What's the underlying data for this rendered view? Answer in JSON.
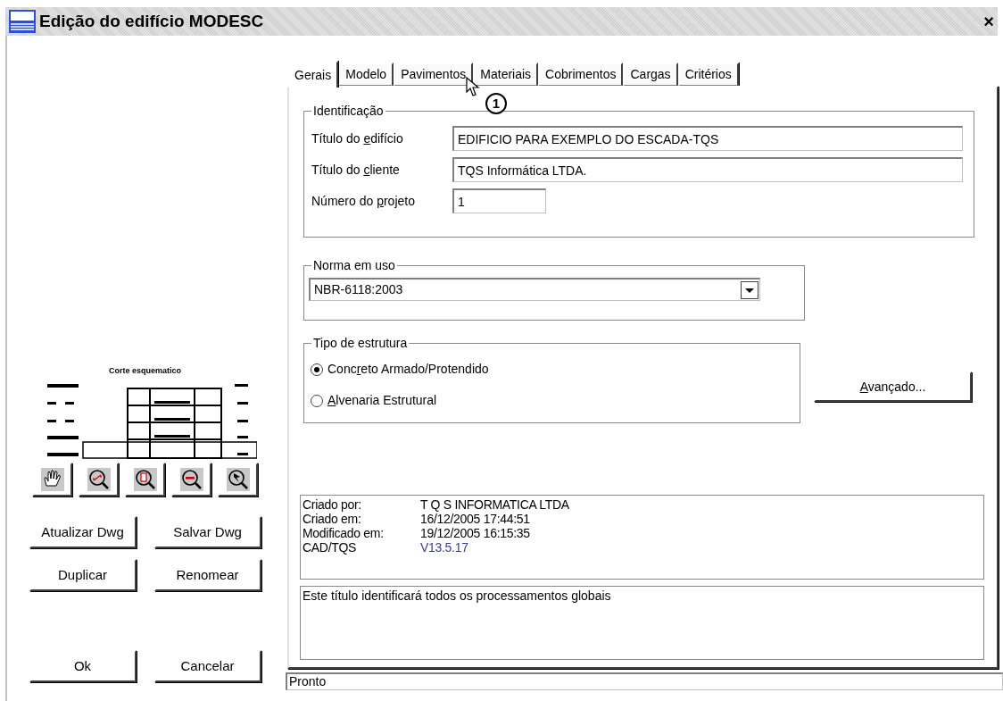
{
  "window": {
    "title": "Edição do edifício MODESC",
    "close": "×"
  },
  "preview": {
    "caption": "Corte esquematico"
  },
  "zoom_tools": [
    {
      "kind": "pan"
    },
    {
      "kind": "zoom-window"
    },
    {
      "kind": "zoom-page"
    },
    {
      "kind": "zoom-out"
    },
    {
      "kind": "zoom-previous"
    }
  ],
  "left_buttons": [
    {
      "label": "Atualizar Dwg"
    },
    {
      "label": "Salvar Dwg"
    },
    {
      "label": "Duplicar"
    },
    {
      "label": "Renomear"
    }
  ],
  "dialog_buttons": [
    {
      "label": "Ok"
    },
    {
      "label": "Cancelar"
    }
  ],
  "tabs": [
    {
      "label": "Gerais",
      "selected": true
    },
    {
      "label": "Modelo",
      "selected": false
    },
    {
      "label": "Pavimentos",
      "selected": false
    },
    {
      "label": "Materiais",
      "selected": false
    },
    {
      "label": "Cobrimentos",
      "selected": false
    },
    {
      "label": "Cargas",
      "selected": false
    },
    {
      "label": "Critérios",
      "selected": false
    }
  ],
  "callout": "1",
  "identificacao": {
    "title": "Identificação",
    "fields": [
      {
        "label": {
          "pre": "Título do ",
          "key": "e",
          "post": "difício"
        },
        "value": "EDIFICIO PARA EXEMPLO DO ESCADA-TQS",
        "kind": "wide"
      },
      {
        "label": {
          "pre": "Título do ",
          "key": "c",
          "post": "liente"
        },
        "value": "TQS Informática LTDA.",
        "kind": "wide"
      },
      {
        "label": {
          "pre": "Número do ",
          "key": "p",
          "post": "rojeto"
        },
        "value": "1",
        "kind": "short"
      }
    ]
  },
  "norma": {
    "title": "Norma em uso",
    "value": "NBR-6118:2003"
  },
  "tipo": {
    "title": "Tipo de estrutura",
    "options": [
      {
        "label": {
          "pre": "Conc",
          "key": "r",
          "post": "eto Armado/Protendido"
        },
        "selected": true
      },
      {
        "label": {
          "key": "A",
          "post": "lvenaria Estrutural"
        },
        "selected": false
      }
    ]
  },
  "advanced_button": {
    "key": "A",
    "post": "vançado..."
  },
  "info": [
    {
      "label": "Criado por:",
      "value": "T Q S  INFORMATICA LTDA",
      "color": "#000000"
    },
    {
      "label": "Criado em:",
      "value": "16/12/2005 17:44:51",
      "color": "#000000"
    },
    {
      "label": "Modificado em:",
      "value": "19/12/2005 16:15:35",
      "color": "#000000"
    },
    {
      "label": "CAD/TQS",
      "value": "V13.5.17",
      "color": "#3a3a9a"
    }
  ],
  "description": "Este título identificará todos os processamentos globais",
  "status_bar": "Pronto"
}
